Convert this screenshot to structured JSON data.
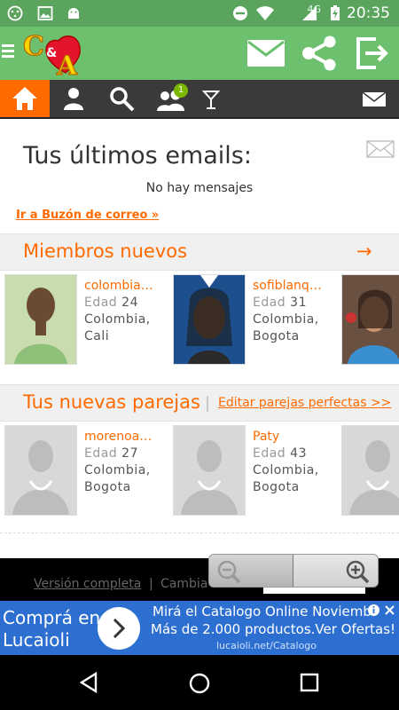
{
  "status": {
    "time": "20:35",
    "network": "4G"
  },
  "nav": {
    "items": [
      "home",
      "profile",
      "search",
      "matches",
      "cocktail",
      "mail"
    ],
    "badge": "1"
  },
  "emails": {
    "title": "Tus últimos emails:",
    "empty": "No hay mensajes",
    "link": "Ir a Buzón de correo »"
  },
  "new_members": {
    "title": "Miembros nuevos",
    "arrow": "→",
    "members": [
      {
        "name": "colombia…",
        "age_label": "Edad",
        "age": "24",
        "country": "Colombia,",
        "city": "Cali"
      },
      {
        "name": "sofiblanq…",
        "age_label": "Edad",
        "age": "31",
        "country": "Colombia,",
        "city": "Bogota"
      }
    ]
  },
  "matches": {
    "title": "Tus nuevas parejas",
    "sep": "|",
    "edit_link": "Editar parejas perfectas >>",
    "members": [
      {
        "name": "morenoa…",
        "age_label": "Edad",
        "age": "27",
        "country": "Colombia,",
        "city": "Bogota"
      },
      {
        "name": "Paty",
        "age_label": "Edad",
        "age": "43",
        "country": "Colombia,",
        "city": "Bogota"
      }
    ]
  },
  "footer": {
    "full_version": "Versión completa",
    "sep": "|",
    "change": "Cambia"
  },
  "ad": {
    "left_line1": "Comprá en",
    "left_line2": "Lucaioli",
    "line1": "Mirá el Catalogo Online Noviemb",
    "line2": "Más de 2.000 productos.Ver Ofertas!",
    "url": "lucaioli.net/Catalogo"
  },
  "colors": {
    "status_bar": "#5aa45e",
    "app_bar": "#6cc06e",
    "accent": "#ff6a00",
    "nav_bg": "#3a3a3a",
    "ad_bg": "#2d6fd1"
  }
}
